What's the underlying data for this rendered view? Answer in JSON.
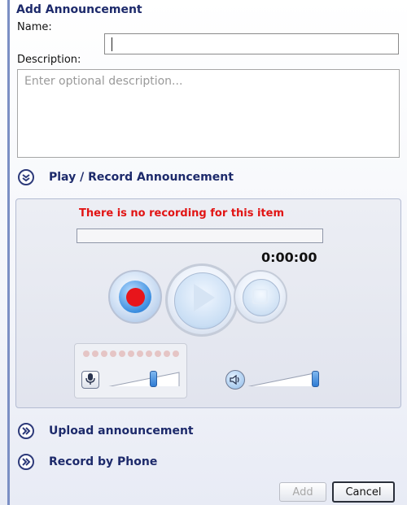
{
  "dialog": {
    "title": "Add Announcement",
    "name_label": "Name:",
    "name_value": "",
    "description_label": "Description:",
    "description_placeholder": "Enter optional description...",
    "description_value": ""
  },
  "sections": {
    "play_record": {
      "label": "Play / Record Announcement",
      "icon": "collapse-icon"
    },
    "upload": {
      "label": "Upload announcement",
      "icon": "expand-icon"
    },
    "record_phone": {
      "label": "Record by Phone",
      "icon": "expand-icon"
    }
  },
  "player": {
    "status_message": "There is no recording for this item",
    "status_color": "#e11414",
    "progress": 0,
    "time": "0:00:00",
    "record_button": "record-icon",
    "play_button": "play-icon",
    "stop_button": "stop-icon",
    "mic_level_leds": 11,
    "mic_volume": 0.65,
    "speaker_volume": 1.0
  },
  "buttons": {
    "add": "Add",
    "cancel": "Cancel"
  },
  "colors": {
    "accent": "#1d2a6b",
    "record": "#e8151b",
    "slider": "#2f7cd4"
  }
}
